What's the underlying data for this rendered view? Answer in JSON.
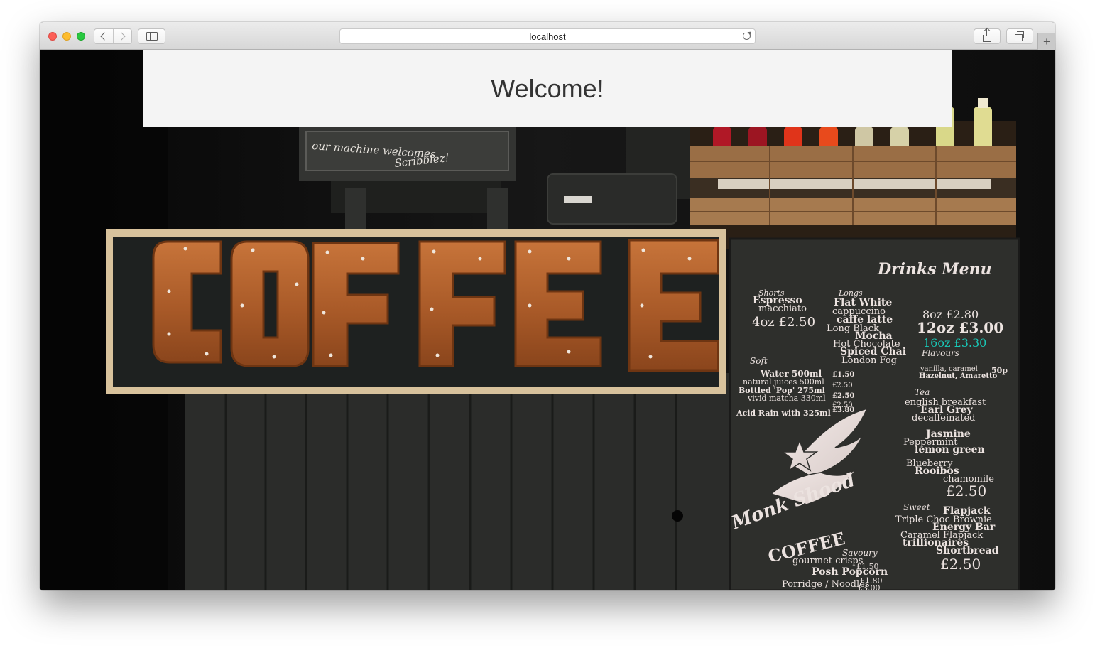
{
  "browser": {
    "url": "localhost",
    "icons": {
      "back": "chevron-left-icon",
      "forward": "chevron-right-icon",
      "sidebar": "sidebar-icon",
      "reload": "reload-icon",
      "share": "share-icon",
      "tabs": "tabs-overview-icon",
      "new_tab": "plus-icon"
    },
    "new_tab_glyph": "+"
  },
  "page": {
    "heading": "Welcome!",
    "background_image": "coffee-shop-photo",
    "photo_sign": "COFFEE",
    "machine_note": [
      "our machine welcomes",
      "Scribblez!"
    ],
    "menu_board": {
      "title": "Drinks Menu",
      "shorts": {
        "heading": "Shorts",
        "items": [
          "Espresso",
          "macchiato"
        ],
        "price_line": "4oz £2.50"
      },
      "longs": {
        "heading": "Longs",
        "items": [
          "Flat White",
          "cappuccino",
          "caffe latte",
          "Long Black",
          "Mocha",
          "Hot Chocolate",
          "Spiced Chai",
          "London Fog"
        ],
        "price_lines": [
          "8oz £2.80",
          "12oz £3.00",
          "16oz £3.30"
        ]
      },
      "flavours": {
        "heading": "Flavours",
        "text": "vanilla, caramel Hazelnut, Amaretto",
        "price": "50p"
      },
      "soft": {
        "heading": "Soft",
        "rows": [
          {
            "name": "Water 500ml",
            "price": "£1.50"
          },
          {
            "name": "natural juices 500ml",
            "price": "£2.50"
          },
          {
            "name": "Bottled 'Pop' 275ml",
            "price": "£2.50"
          },
          {
            "name": "vivid matcha 330ml",
            "price": "£2.50"
          },
          {
            "name": "Acid Rain with 325ml",
            "price": "£3.80"
          }
        ]
      },
      "tea": {
        "heading": "Tea",
        "items": [
          "english breakfast",
          "Earl Grey",
          "decaffeinated",
          "Jasmine",
          "Peppermint",
          "lemon green",
          "Blueberry",
          "Rooibos",
          "chamomile"
        ],
        "price": "£2.50"
      },
      "sweet": {
        "heading": "Sweet",
        "items": [
          "Flapjack",
          "Triple Choc Brownie",
          "Energy Bar",
          "Caramel Flapjack",
          "trillionaires",
          "Shortbread"
        ],
        "price": "£2.50"
      },
      "savoury": {
        "heading": "Savoury",
        "rows": [
          {
            "name": "gourmet crisps",
            "price": "£1.50"
          },
          {
            "name": "Posh Popcorn",
            "price": ""
          },
          {
            "name": "Porridge / Noodles",
            "price": "£1.80"
          },
          {
            "name": "",
            "price": "£3.00"
          }
        ]
      },
      "logo_text": [
        "Monk Shood",
        "COFFEE"
      ]
    }
  },
  "colors": {
    "banner_bg": "#f4f4f4",
    "heading_text": "#333333",
    "sign_letters": "#b4612d",
    "chalkboard": "#2e2f2c",
    "chalk": "#ece3e0",
    "teal_chalk": "#19c7b6",
    "wood_frame": "#d8c29c"
  }
}
